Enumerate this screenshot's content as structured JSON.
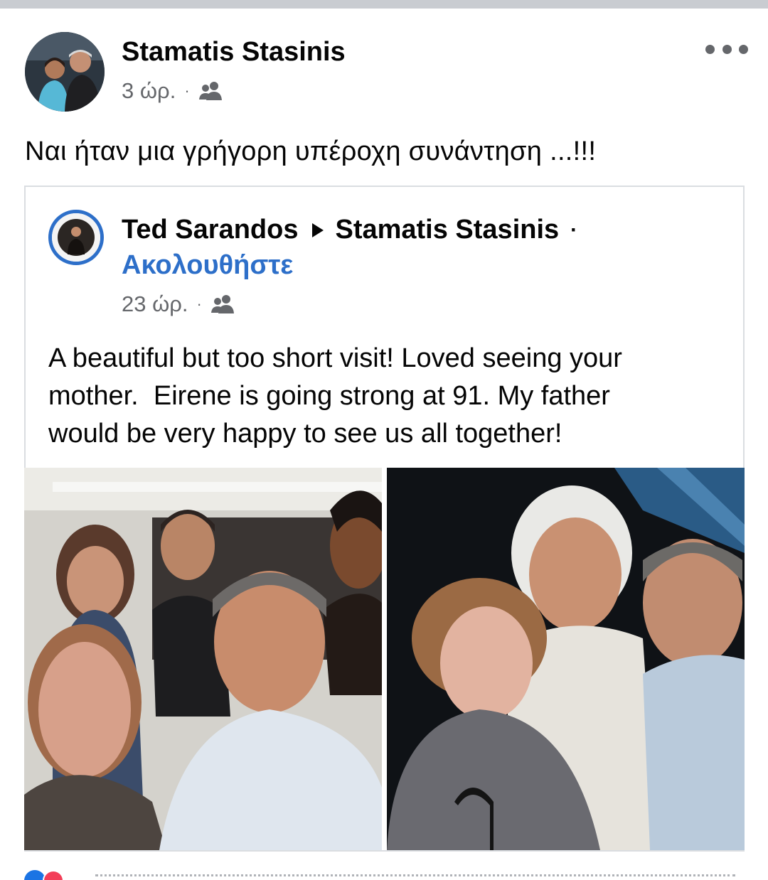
{
  "post": {
    "author": "Stamatis Stasinis",
    "time": "3 ώρ.",
    "separator": "·",
    "audience_icon": "friends-icon",
    "text": "Ναι ήταν μια γρήγορη υπέροχη συνάντηση ...!!!"
  },
  "shared": {
    "author": "Ted Sarandos",
    "target": "Stamatis Stasinis",
    "separator": "·",
    "follow_label": "Ακολουθήστε",
    "time": "23 ώρ.",
    "audience_icon": "friends-icon",
    "text_lines": [
      "A beautiful but too short visit! Loved seeing your",
      "mother.  Eirene is going strong at 91. My father",
      "would be very happy to see us all together!"
    ]
  },
  "colors": {
    "link": "#2d6fc9",
    "meta": "#65676b",
    "like": "#1b74e4",
    "love": "#f33e58"
  }
}
